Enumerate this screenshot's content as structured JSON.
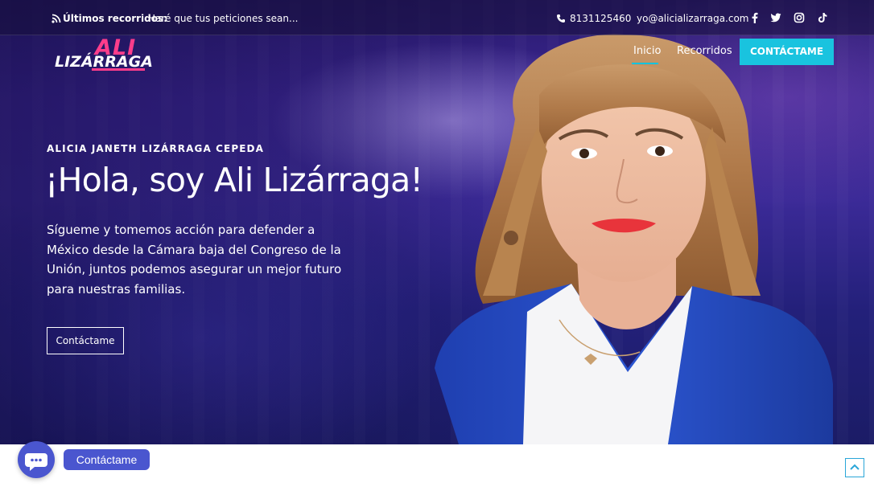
{
  "topbar": {
    "news_label": "Últimos recorridos:",
    "news_text": "Haré que tus peticiones sean...",
    "phone": "8131125460",
    "email": "yo@alicializarraga.com",
    "social_icons": [
      "facebook-icon",
      "twitter-icon",
      "instagram-icon",
      "tiktok-icon"
    ]
  },
  "logo": {
    "line1": "ALI",
    "line2": "LIZÁRRAGA"
  },
  "nav": {
    "items": [
      {
        "label": "Inicio",
        "active": true
      },
      {
        "label": "Recorridos",
        "active": false
      }
    ],
    "cta": "CONTÁCTAME"
  },
  "hero": {
    "kicker": "ALICIA JANETH LIZÁRRAGA CEPEDA",
    "headline": "¡Hola, soy Ali Lizárraga!",
    "lead": "Sígueme y tomemos acción para defender a México desde la Cámara baja del Congreso de la Unión, juntos podemos asegurar un mejor futuro para nuestras familias.",
    "button": "Contáctame"
  },
  "chat": {
    "label": "Contáctame"
  },
  "colors": {
    "accent": "#19c3df",
    "brand_pink": "#ff3d8b",
    "chat": "#4a56cf",
    "hero_bg": "#3a2590"
  }
}
